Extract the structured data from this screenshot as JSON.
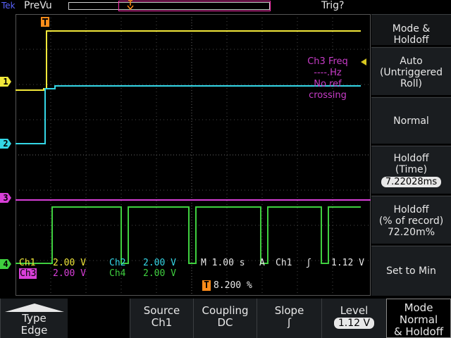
{
  "topbar": {
    "brand": "Tek",
    "state": "PreVu",
    "trigger_status": "Trig?"
  },
  "trigger_marker": "T",
  "channel_markers": [
    "1",
    "2",
    "3",
    "4"
  ],
  "measurement": {
    "line1": "Ch3 Freq",
    "line2": "----.Hz",
    "line3": "No ref",
    "line4": "crossing"
  },
  "readout": {
    "ch1_label": "Ch1",
    "ch1_scale": "2.00 V",
    "ch2_label": "Ch2",
    "ch2_scale": "2.00 V",
    "ch3_label": "Ch3",
    "ch3_scale": "2.00 V",
    "ch4_label": "Ch4",
    "ch4_scale": "2.00 V",
    "timebase": "M 1.00 s",
    "trig_mode": "A",
    "trig_source": "Ch1",
    "trig_slope": "ʃ",
    "trig_level": "1.12 V",
    "trig_pos_marker": "T",
    "trig_pos_value": "8.200 %"
  },
  "sidemenu": {
    "mode_holdoff": {
      "line1": "Mode &",
      "line2": "Holdoff"
    },
    "auto": {
      "line1": "Auto",
      "line2": "(Untriggered",
      "line3": "Roll)"
    },
    "normal": {
      "label": "Normal"
    },
    "holdoff_time": {
      "line1": "Holdoff",
      "line2": "(Time)",
      "value": "7.22028ms"
    },
    "holdoff_record": {
      "line1": "Holdoff",
      "line2": "(% of record)",
      "value": "72.20m%"
    },
    "set_to_min": {
      "label": "Set to Min"
    }
  },
  "bottommenu": {
    "type": {
      "line1": "Type",
      "line2": "Edge"
    },
    "source": {
      "line1": "Source",
      "line2": "Ch1"
    },
    "coupling": {
      "line1": "Coupling",
      "line2": "DC"
    },
    "slope": {
      "line1": "Slope",
      "line2": "ʃ"
    },
    "level": {
      "line1": "Level",
      "value": "1.12 V"
    },
    "mode": {
      "line1": "Mode",
      "line2": "Normal",
      "line3": "& Holdoff"
    }
  },
  "colors": {
    "ch1": "#f2e83a",
    "ch2": "#34d6e6",
    "ch3": "#d83fd8",
    "ch4": "#3fcf3f",
    "trigger": "#ff8c1a"
  }
}
